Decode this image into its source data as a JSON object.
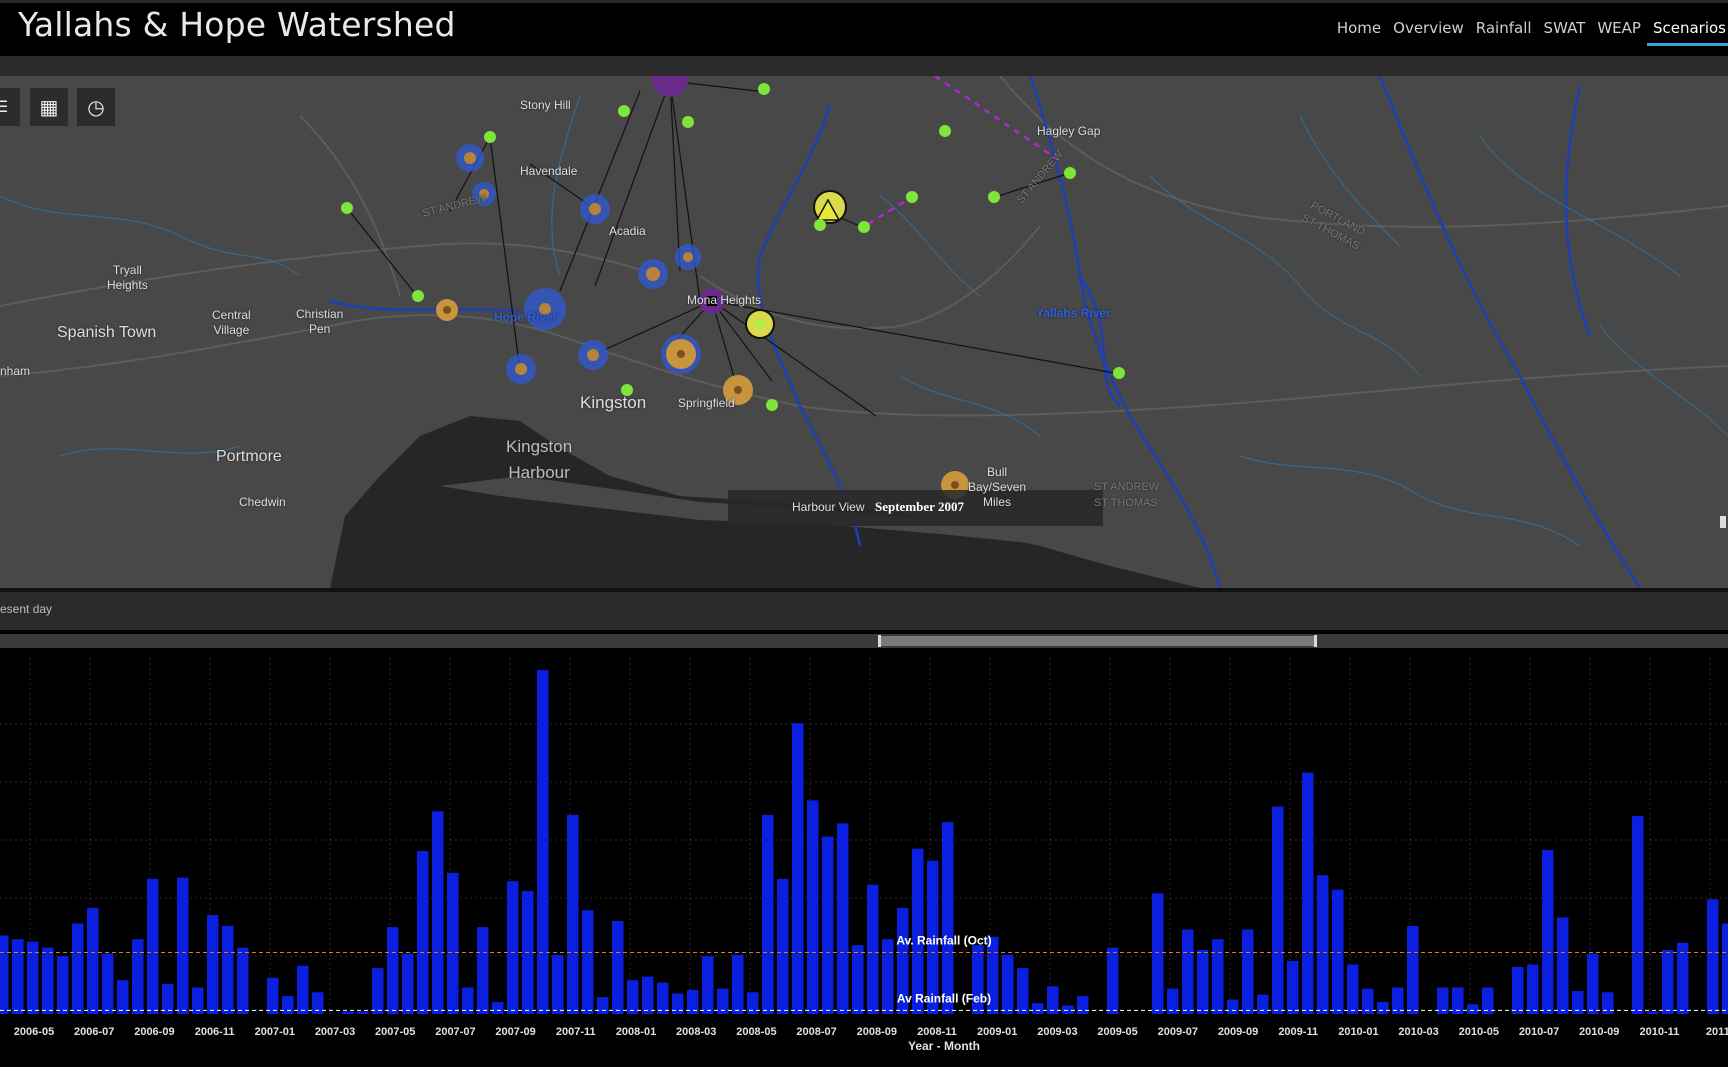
{
  "app": {
    "title": "Yallahs & Hope Watershed",
    "nav": [
      "Home",
      "Overview",
      "Rainfall",
      "SWAT",
      "WEAP",
      "Scenarios"
    ],
    "active_nav": "Scenarios"
  },
  "map": {
    "buttons": [
      {
        "name": "menu-icon",
        "glyph": "☰"
      },
      {
        "name": "grid-icon",
        "glyph": "▦"
      },
      {
        "name": "history-icon",
        "glyph": "◷"
      }
    ],
    "places": [
      "Stony Hill",
      "Havendale",
      "Acadia",
      "Hagley Gap",
      "Tryall\nHeights",
      "Mona Heights",
      "Hope River",
      "Yallahs River",
      "Central\nVillage",
      "Christian\nPen",
      "Spanish Town",
      "nham",
      "Kingston",
      "Springfield",
      "Kingston\nHarbour",
      "Portmore",
      "Chedwin",
      "Harbour View",
      "Bull\nBay/Seven\nMiles",
      "ST ANDREW",
      "ST THOMAS",
      "ST ANDREW",
      "PORTLAND\nST THOMAS",
      "ST ANDREW"
    ],
    "tooltip": "September 2007"
  },
  "status": {
    "text": "esent day"
  },
  "chart_data": {
    "type": "bar",
    "xlabel": "Year - Month",
    "tick_labels": [
      "2006-05",
      "2006-07",
      "2006-09",
      "2006-11",
      "2007-01",
      "2007-03",
      "2007-05",
      "2007-07",
      "2007-09",
      "2007-11",
      "2008-01",
      "2008-03",
      "2008-05",
      "2008-07",
      "2008-09",
      "2008-11",
      "2009-01",
      "2009-03",
      "2009-05",
      "2009-07",
      "2009-09",
      "2009-11",
      "2010-01",
      "2010-03",
      "2010-05",
      "2010-07",
      "2010-09",
      "2010-11",
      "2011-"
    ],
    "bar_color": "#0b1fe0",
    "values": [
      65,
      62,
      60,
      55,
      48,
      75,
      88,
      50,
      28,
      62,
      112,
      25,
      113,
      22,
      82,
      73,
      55,
      0,
      30,
      15,
      40,
      18,
      0,
      2,
      2,
      38,
      72,
      50,
      135,
      168,
      117,
      22,
      72,
      10,
      110,
      102,
      285,
      49,
      165,
      86,
      14,
      77,
      28,
      31,
      26,
      17,
      20,
      48,
      21,
      49,
      18,
      165,
      112,
      241,
      177,
      147,
      158,
      57,
      107,
      62,
      88,
      137,
      127,
      159,
      0,
      57,
      64,
      49,
      38,
      9,
      23,
      7,
      15,
      0,
      55,
      0,
      0,
      100,
      21,
      70,
      53,
      62,
      12,
      70,
      16,
      172,
      44,
      200,
      115,
      103,
      41,
      21,
      10,
      22,
      73,
      0,
      22,
      22,
      8,
      22,
      0,
      39,
      41,
      136,
      80,
      19,
      50,
      18,
      0,
      164,
      2,
      53,
      59,
      0,
      95,
      75,
      122,
      0,
      0,
      144,
      28,
      45
    ],
    "reference_lines": [
      {
        "label": "Av. Rainfall (Oct)",
        "value": 51,
        "color": "#e07b1a"
      },
      {
        "label": "Av Rainfall (Feb)",
        "value": 3,
        "color": "#ffffff"
      }
    ],
    "ylim": [
      0,
      295
    ],
    "grid": true
  }
}
